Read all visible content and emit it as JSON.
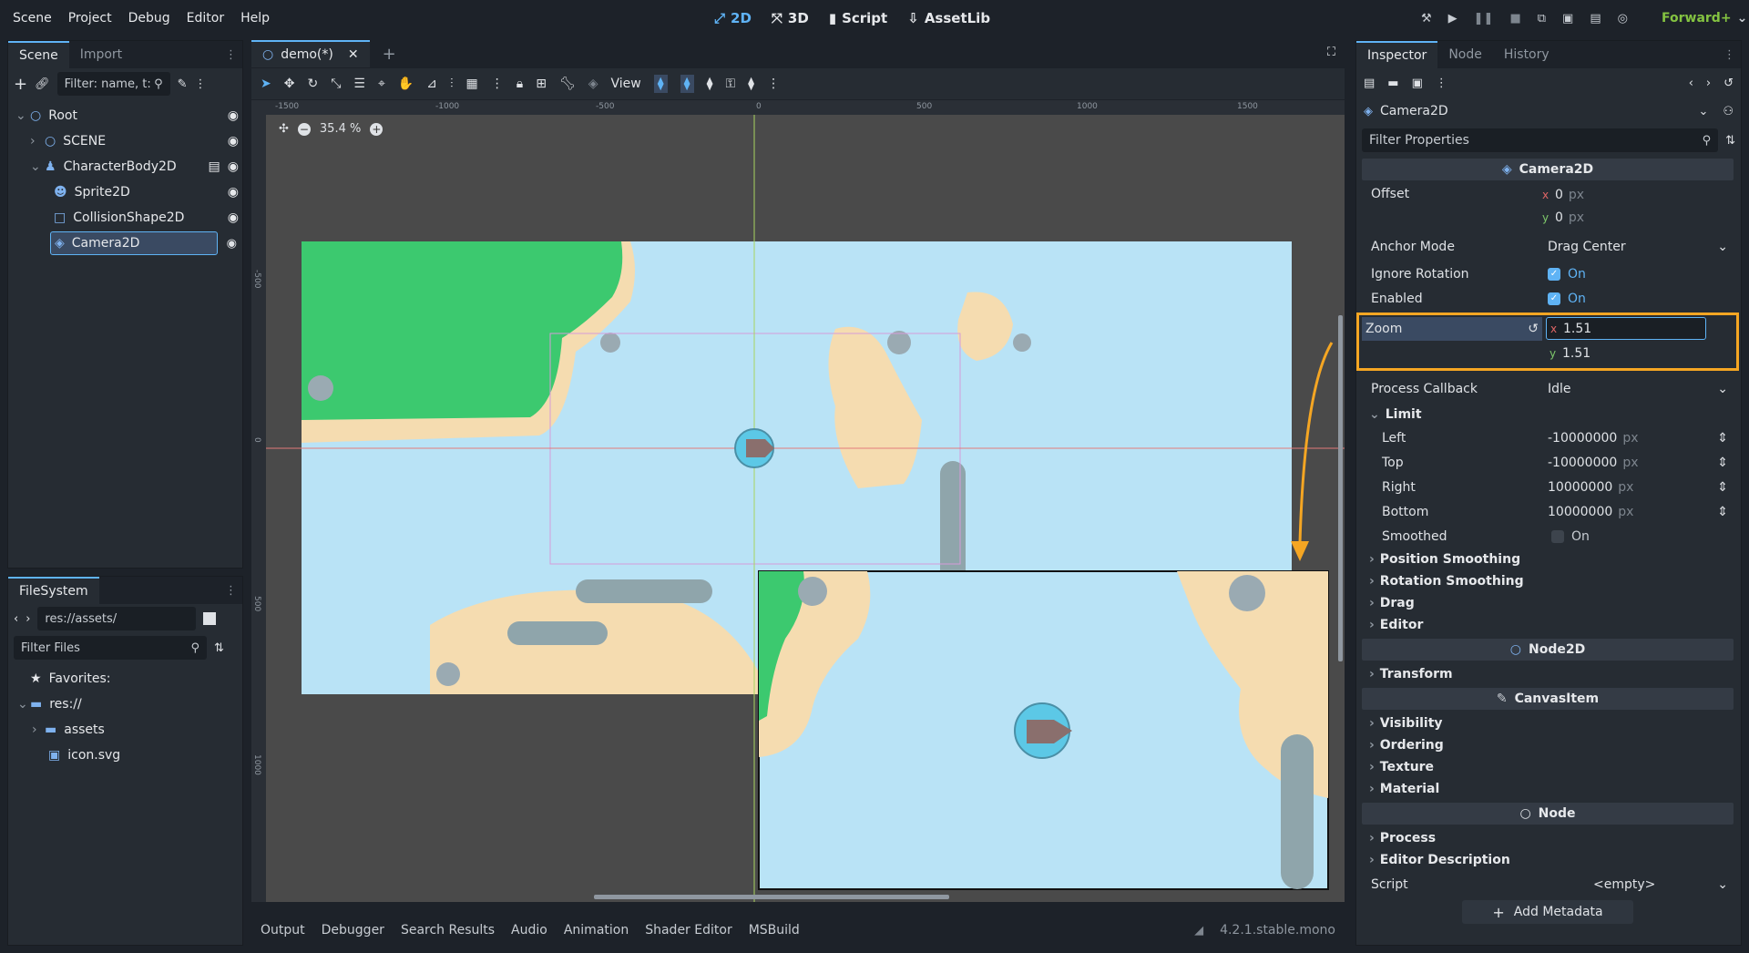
{
  "menubar": {
    "menu": [
      "Scene",
      "Project",
      "Debug",
      "Editor",
      "Help"
    ],
    "modes": [
      {
        "label": "2D",
        "icon": "2d-icon",
        "active": true
      },
      {
        "label": "3D",
        "icon": "3d-icon",
        "active": false
      },
      {
        "label": "Script",
        "icon": "script-icon",
        "active": false
      },
      {
        "label": "AssetLib",
        "icon": "assetlib-icon",
        "active": false
      }
    ],
    "renderer": "Forward+"
  },
  "scene_dock": {
    "tabs": [
      "Scene",
      "Import"
    ],
    "filter_placeholder": "Filter: name, t:",
    "tree": [
      {
        "label": "Root",
        "icon": "node2d-icon",
        "depth": 0
      },
      {
        "label": "SCENE",
        "icon": "node2d-icon",
        "depth": 1
      },
      {
        "label": "CharacterBody2D",
        "icon": "characterbody-icon",
        "depth": 1
      },
      {
        "label": "Sprite2D",
        "icon": "sprite-icon",
        "depth": 2
      },
      {
        "label": "CollisionShape2D",
        "icon": "collision-icon",
        "depth": 2
      },
      {
        "label": "Camera2D",
        "icon": "camera-icon",
        "depth": 2,
        "selected": true
      }
    ]
  },
  "filesystem_dock": {
    "tab": "FileSystem",
    "path": "res://assets/",
    "filter_placeholder": "Filter Files",
    "items": [
      {
        "label": "Favorites:",
        "icon": "star-icon"
      },
      {
        "label": "res://",
        "icon": "folder-icon"
      },
      {
        "label": "assets",
        "icon": "folder-icon"
      },
      {
        "label": "icon.svg",
        "icon": "svg-file-icon"
      }
    ]
  },
  "editor": {
    "tab": "demo(*)",
    "view_label": "View",
    "zoom_level": "35.4 %",
    "ruler_ticks": [
      "-1500",
      "-1000",
      "-500",
      "0",
      "500",
      "1000",
      "1500"
    ],
    "vruler_ticks": [
      "-500",
      "0",
      "500",
      "1000"
    ]
  },
  "bottom_panel": {
    "tabs": [
      "Output",
      "Debugger",
      "Search Results",
      "Audio",
      "Animation",
      "Shader Editor",
      "MSBuild"
    ],
    "version": "4.2.1.stable.mono"
  },
  "inspector": {
    "tabs": [
      "Inspector",
      "Node",
      "History"
    ],
    "node_name": "Camera2D",
    "filter_placeholder": "Filter Properties",
    "class_header": "Camera2D",
    "offset": {
      "label": "Offset",
      "x": "0",
      "y": "0",
      "unit": "px"
    },
    "anchor_mode": {
      "label": "Anchor Mode",
      "value": "Drag Center"
    },
    "ignore_rotation": {
      "label": "Ignore Rotation",
      "value": "On"
    },
    "enabled": {
      "label": "Enabled",
      "value": "On"
    },
    "zoom": {
      "label": "Zoom",
      "x": "1.51",
      "y": "1.51"
    },
    "process_callback": {
      "label": "Process Callback",
      "value": "Idle"
    },
    "limit": {
      "label": "Limit",
      "left": {
        "label": "Left",
        "value": "-10000000"
      },
      "top": {
        "label": "Top",
        "value": "-10000000"
      },
      "right": {
        "label": "Right",
        "value": "10000000"
      },
      "bottom": {
        "label": "Bottom",
        "value": "10000000"
      },
      "unit": "px",
      "smoothed": {
        "label": "Smoothed",
        "value": "On"
      }
    },
    "groups1": [
      "Position Smoothing",
      "Rotation Smoothing",
      "Drag",
      "Editor"
    ],
    "node2d_header": "Node2D",
    "groups2": [
      "Transform"
    ],
    "canvasitem_header": "CanvasItem",
    "groups3": [
      "Visibility",
      "Ordering",
      "Texture",
      "Material"
    ],
    "node_header": "Node",
    "groups4": [
      "Process",
      "Editor Description"
    ],
    "script": {
      "label": "Script",
      "value": "<empty>"
    },
    "add_metadata": "Add Metadata"
  },
  "colors": {
    "accent": "#5fb3f5",
    "highlight": "#f5a623",
    "grass": "#3cc96f",
    "water": "#b9e3f6",
    "sand": "#f5dcb0"
  }
}
